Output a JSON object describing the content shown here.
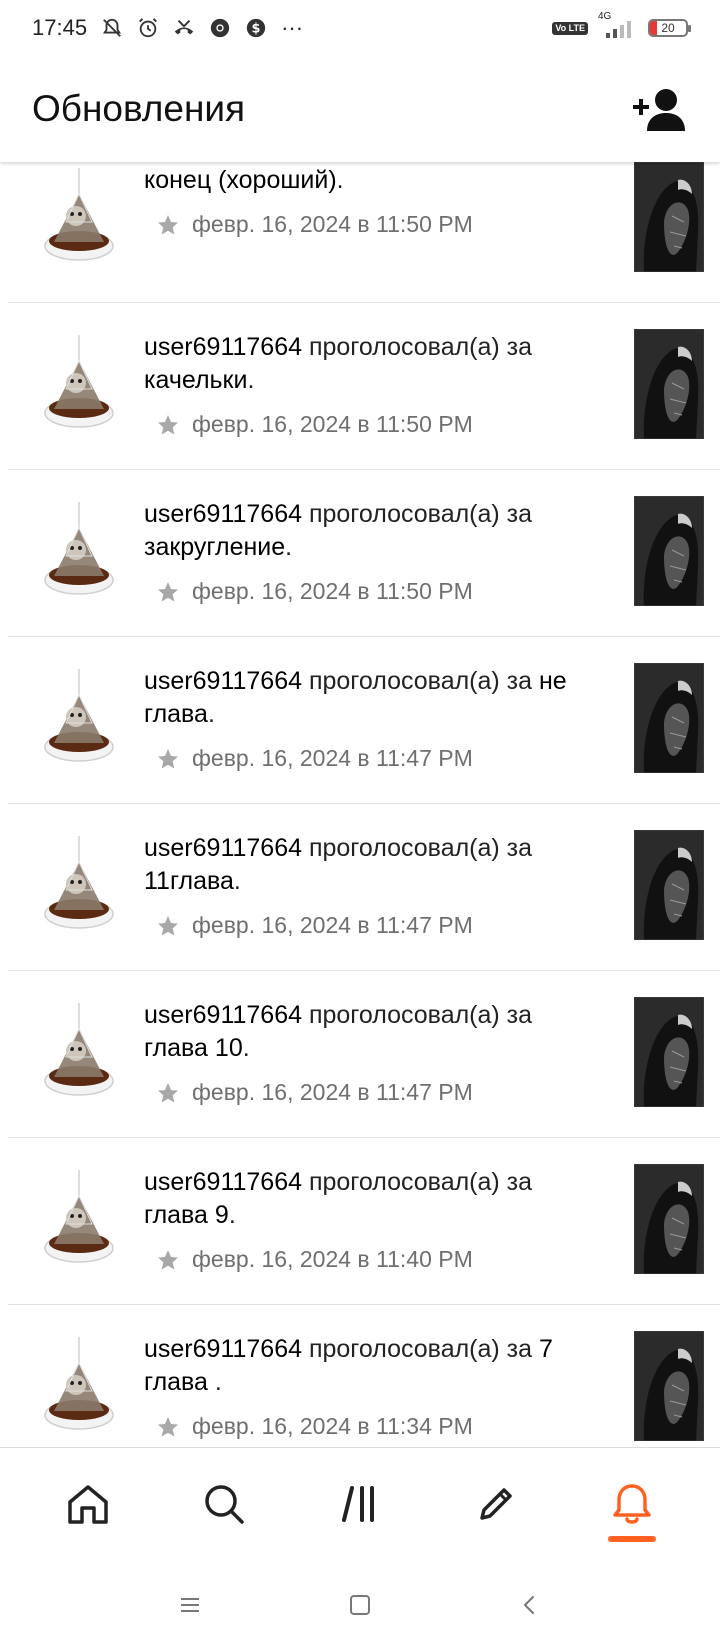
{
  "status_bar": {
    "time": "17:45",
    "network": "4G",
    "volte": "Vo LTE",
    "battery": "20",
    "battery_level": 0.2,
    "more": "···"
  },
  "header": {
    "title": "Обновления",
    "add_user_icon": "add-user-icon"
  },
  "feed": {
    "items": [
      {
        "user": "",
        "action": "",
        "target": "конец (хороший)",
        "suffix": ".",
        "date": "февр. 16, 2024 в 11:50 PM"
      },
      {
        "user": "user69117664",
        "action": " проголосовал(а) за ",
        "target": "качельки",
        "suffix": ".",
        "date": "февр. 16, 2024 в 11:50 PM"
      },
      {
        "user": "user69117664",
        "action": " проголосовал(а) за ",
        "target": "закругление",
        "suffix": ".",
        "date": "февр. 16, 2024 в 11:50 PM"
      },
      {
        "user": "user69117664",
        "action": " проголосовал(а) за ",
        "target": "не глава",
        "suffix": ".",
        "date": "февр. 16, 2024 в 11:47 PM"
      },
      {
        "user": "user69117664",
        "action": " проголосовал(а) за ",
        "target": "11глава",
        "suffix": ".",
        "date": "февр. 16, 2024 в 11:47 PM"
      },
      {
        "user": "user69117664",
        "action": " проголосовал(а) за ",
        "target": "глава 10",
        "suffix": ".",
        "date": "февр. 16, 2024 в 11:47 PM"
      },
      {
        "user": "user69117664",
        "action": " проголосовал(а) за ",
        "target": "глава 9",
        "suffix": ".",
        "date": "февр. 16, 2024 в 11:40 PM"
      },
      {
        "user": "user69117664",
        "action": " проголосовал(а) за ",
        "target": "7 глава ",
        "suffix": ".",
        "date": "февр. 16, 2024 в 11:34 PM"
      }
    ]
  },
  "bottom_nav": {
    "items": [
      {
        "icon": "home-icon"
      },
      {
        "icon": "search-icon"
      },
      {
        "icon": "library-icon"
      },
      {
        "icon": "write-icon"
      },
      {
        "icon": "notifications-icon",
        "active": true
      }
    ]
  },
  "colors": {
    "accent": "#ff6122",
    "text": "#1a1a1a",
    "meta": "#6f6f6f",
    "divider": "#e3e3e3"
  }
}
